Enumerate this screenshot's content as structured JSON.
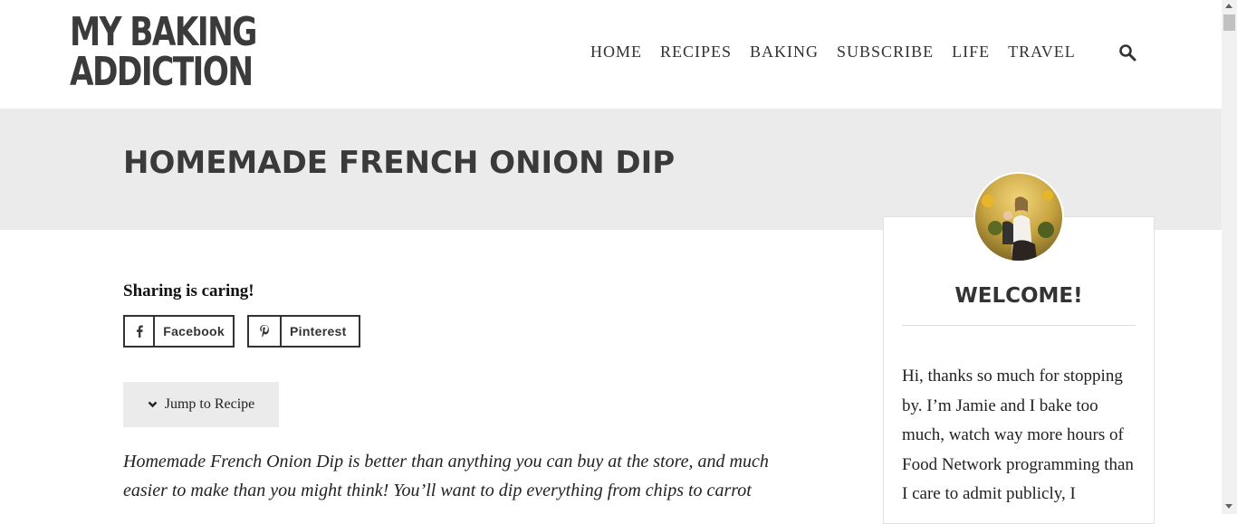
{
  "logo": {
    "line1": "MY BAKING",
    "line2": "ADDICTION"
  },
  "nav": {
    "items": [
      "HOME",
      "RECIPES",
      "BAKING",
      "SUBSCRIBE",
      "LIFE",
      "TRAVEL"
    ]
  },
  "post": {
    "title": "HOMEMADE FRENCH ONION DIP"
  },
  "share": {
    "label": "Sharing is caring!",
    "facebook": "Facebook",
    "pinterest": "Pinterest"
  },
  "jump": {
    "label": "Jump to Recipe"
  },
  "intro": "Homemade French Onion Dip is better than anything you can buy at the store, and much easier to make than you might think! You’ll want to dip everything from chips to carrot",
  "sidebar": {
    "welcome_title": "WELCOME!",
    "welcome_text": "Hi, thanks so much for stopping by. I’m Jamie and I bake too much, watch way more hours of Food Network programming than I care to admit publicly, I"
  },
  "colors": {
    "text_dark": "#3a3a3a",
    "band": "#ebebec"
  }
}
